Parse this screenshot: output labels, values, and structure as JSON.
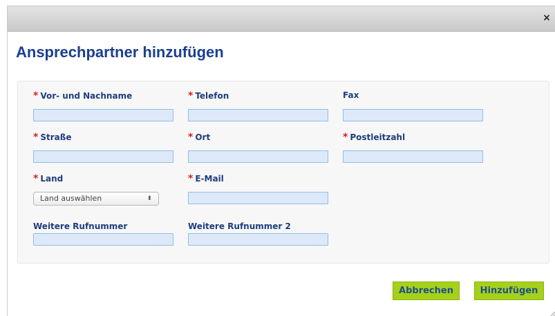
{
  "dialog": {
    "title": "Ansprechpartner hinzufügen",
    "close_glyph": "×"
  },
  "required_marker": "*",
  "form": {
    "name": {
      "label": "Vor- und Nachname",
      "value": "",
      "required": true
    },
    "phone": {
      "label": "Telefon",
      "value": "",
      "required": true
    },
    "fax": {
      "label": "Fax",
      "value": "",
      "required": false
    },
    "street": {
      "label": "Straße",
      "value": "",
      "required": true
    },
    "city": {
      "label": "Ort",
      "value": "",
      "required": true
    },
    "zip": {
      "label": "Postleitzahl",
      "value": "",
      "required": true
    },
    "country": {
      "label": "Land",
      "selected": "Land auswählen",
      "arrows": "⬍",
      "required": true
    },
    "email": {
      "label": "E-Mail",
      "value": "",
      "required": true
    },
    "phone2": {
      "label": "Weitere Rufnummer",
      "value": "",
      "required": false
    },
    "phone3": {
      "label": "Weitere Rufnummer 2",
      "value": "",
      "required": false
    }
  },
  "buttons": {
    "cancel": "Abbrechen",
    "add": "Hinzufügen"
  },
  "colors": {
    "title": "#1a3f8f",
    "label": "#1e3d7d",
    "required": "#d91f1f",
    "input_bg": "#dde9f8",
    "input_border": "#8fbde8",
    "button_bg": "#a6d11b"
  }
}
